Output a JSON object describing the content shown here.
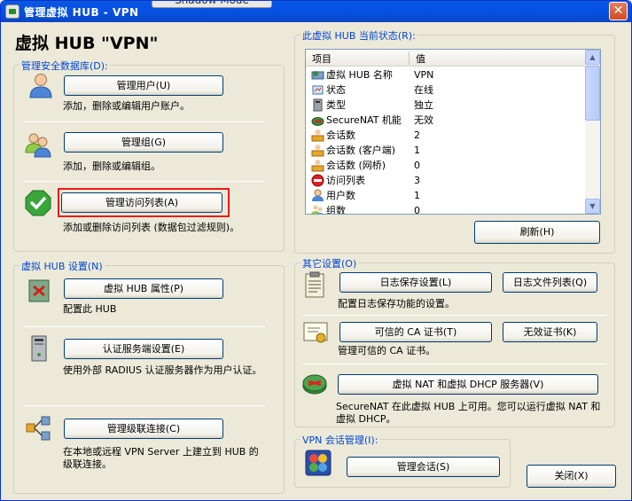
{
  "window": {
    "title": "管理虚拟 HUB - VPN",
    "shadow_tab": "Shadow Mode",
    "close_glyph": "✕"
  },
  "header": {
    "title": "虚拟 HUB \"VPN\""
  },
  "security_group": {
    "legend": "管理安全数据库(D):",
    "users_button": "管理用户(U)",
    "users_desc": "添加，删除或编辑用户账户。",
    "groups_button": "管理组(G)",
    "groups_desc": "添加，删除或编辑组。",
    "acl_button": "管理访问列表(A)",
    "acl_desc": "添加或删除访问列表 (数据包过滤规则)。"
  },
  "status_group": {
    "legend": "此虚拟 HUB 当前状态(R):",
    "columns": [
      "项目",
      "值"
    ],
    "rows": [
      {
        "icon": "hub-icon",
        "name": "虚拟 HUB 名称",
        "value": "VPN"
      },
      {
        "icon": "status-icon",
        "name": "状态",
        "value": "在线"
      },
      {
        "icon": "server-icon",
        "name": "类型",
        "value": "独立"
      },
      {
        "icon": "router-icon",
        "name": "SecureNAT 机能",
        "value": "无效"
      },
      {
        "icon": "session-icon",
        "name": "会话数",
        "value": "2"
      },
      {
        "icon": "session-icon",
        "name": "会话数 (客户端)",
        "value": "1"
      },
      {
        "icon": "session-icon",
        "name": "会话数 (网桥)",
        "value": "0"
      },
      {
        "icon": "access-list-icon",
        "name": "访问列表",
        "value": "3"
      },
      {
        "icon": "user-icon",
        "name": "用户数",
        "value": "1"
      },
      {
        "icon": "group-icon",
        "name": "组数",
        "value": "0"
      }
    ],
    "refresh_button": "刷新(H)"
  },
  "hub_settings_group": {
    "legend": "虚拟 HUB 设置(N)",
    "properties_button": "虚拟 HUB 属性(P)",
    "properties_desc": "配置此 HUB",
    "radius_button": "认证服务端设置(E)",
    "radius_desc": "使用外部 RADIUS 认证服务器作为用户认证。",
    "cascade_button": "管理级联连接(C)",
    "cascade_desc": "在本地或远程 VPN Server 上建立到 HUB 的级联连接。"
  },
  "other_group": {
    "legend": "其它设置(O)",
    "log_settings_button": "日志保存设置(L)",
    "log_files_button": "日志文件列表(Q)",
    "log_desc": "配置日志保存功能的设置。",
    "trusted_ca_button": "可信的 CA 证书(T)",
    "invalid_cert_button": "无效证书(K)",
    "ca_desc": "管理可信的 CA 证书。",
    "securenat_button": "虚拟 NAT 和虚拟 DHCP 服务器(V)",
    "securenat_desc": "SecureNAT 在此虚拟 HUB 上可用。您可以运行虚拟 NAT 和虚拟 DHCP。"
  },
  "session_group": {
    "legend": "VPN 会话管理(I):",
    "sessions_button": "管理会话(S)"
  },
  "footer": {
    "close_button": "关闭(X)"
  },
  "colors": {
    "accent": "#0046d5",
    "highlight_box": "#e81b1b",
    "titlebar": "#0753e6"
  }
}
